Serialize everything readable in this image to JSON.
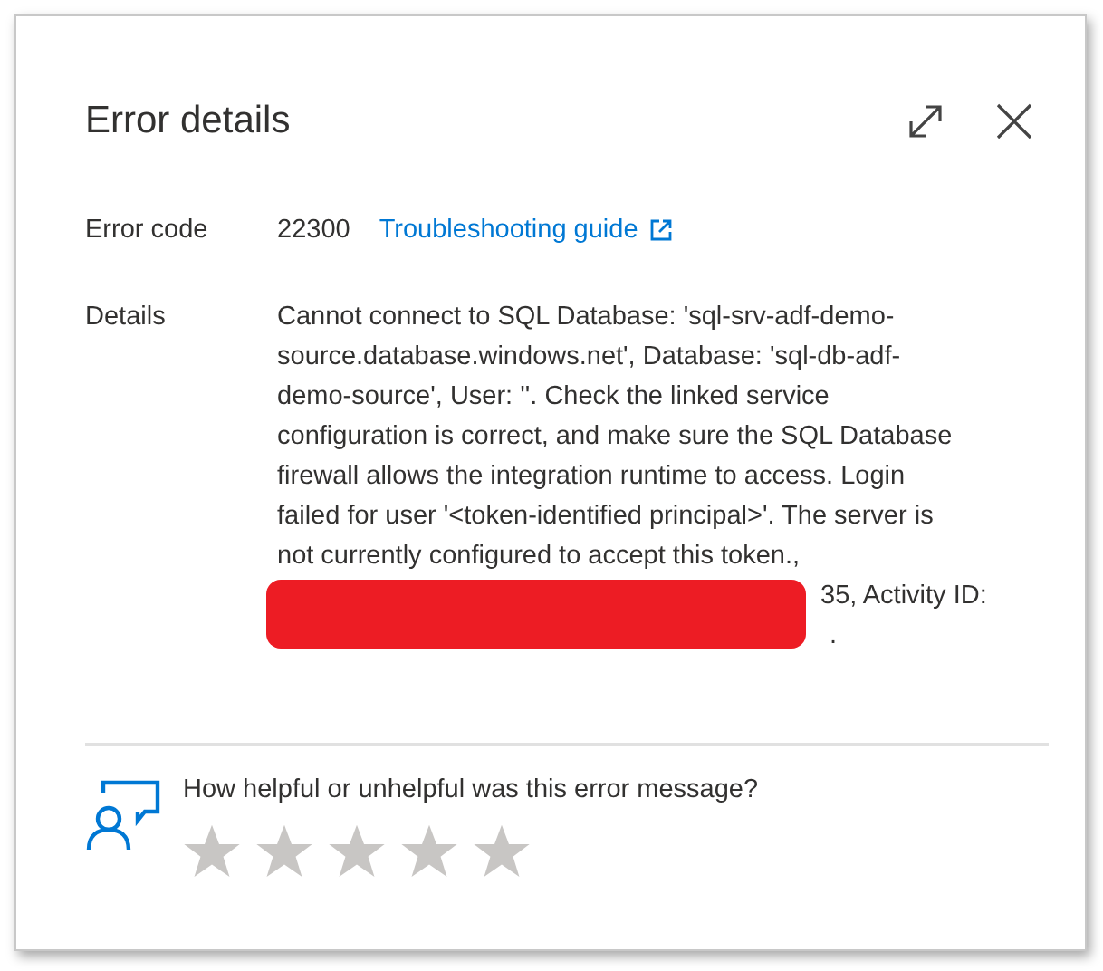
{
  "dialog": {
    "title": "Error details"
  },
  "error_code": {
    "label": "Error code",
    "value": "22300",
    "link": "Troubleshooting guide"
  },
  "details": {
    "label": "Details",
    "lines": [
      "Cannot connect to SQL Database: 'sql-srv-adf-demo-",
      "source.database.windows.net', Database: 'sql-db-adf-",
      "demo-source', User: ''. Check the linked service",
      "configuration is correct, and make sure the SQL Database",
      "firewall allows the integration runtime to access. Login",
      "failed for user '<token-identified principal>'. The server is",
      "not currently configured to accept this token.,"
    ],
    "redacted_tails": [
      "35, Activity ID:",
      "."
    ]
  },
  "feedback": {
    "question": "How helpful or unhelpful was this error message?",
    "stars": 0
  }
}
